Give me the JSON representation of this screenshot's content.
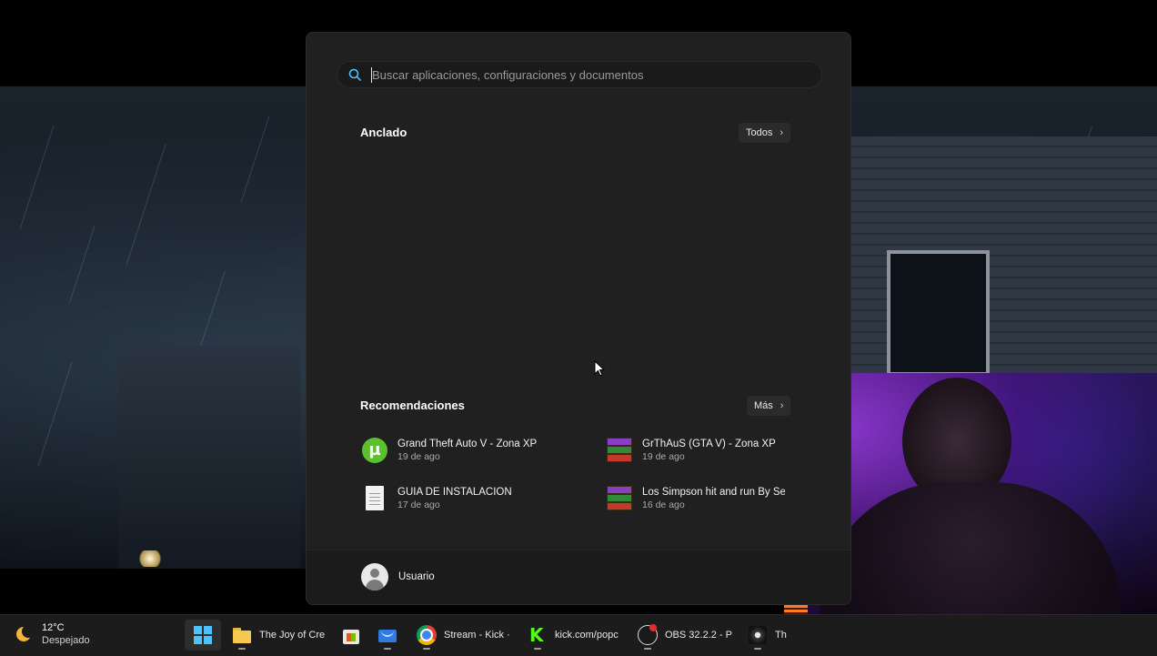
{
  "search": {
    "placeholder": "Buscar aplicaciones, configuraciones y documentos"
  },
  "pinned": {
    "title": "Anclado",
    "all_button": "Todos"
  },
  "recommendations": {
    "title": "Recomendaciones",
    "more_button": "Más",
    "items": [
      {
        "name": "Grand Theft Auto V - Zona XP",
        "date": "19 de ago",
        "icon": "utorrent-icon"
      },
      {
        "name": "GrThAuS (GTA V) - Zona XP",
        "date": "19 de ago",
        "icon": "winrar-icon"
      },
      {
        "name": "GUIA DE INSTALACION",
        "date": "17 de ago",
        "icon": "document-icon"
      },
      {
        "name": "Los Simpson hit and run By Sej",
        "date": "16 de ago",
        "icon": "winrar-icon"
      }
    ]
  },
  "user": {
    "name": "Usuario"
  },
  "taskbar": {
    "weather": {
      "temp": "12°C",
      "condition": "Despejado",
      "icon": "moon-icon"
    },
    "items": [
      {
        "label": "",
        "icon": "windows-start-icon",
        "active": true
      },
      {
        "label": "The Joy of Cre",
        "icon": "folder-icon"
      },
      {
        "label": "",
        "icon": "store-icon"
      },
      {
        "label": "",
        "icon": "mail-icon"
      },
      {
        "label": "Stream - Kick ·",
        "icon": "chrome-icon"
      },
      {
        "label": "kick.com/popc",
        "icon": "kick-icon"
      },
      {
        "label": "OBS 32.2.2 - P",
        "icon": "obs-icon"
      },
      {
        "label": "Th",
        "icon": "game-icon"
      }
    ]
  },
  "colors": {
    "accent": "#4cc2ff",
    "menu_bg": "#202020",
    "taskbar_bg": "#1c1c1c"
  }
}
